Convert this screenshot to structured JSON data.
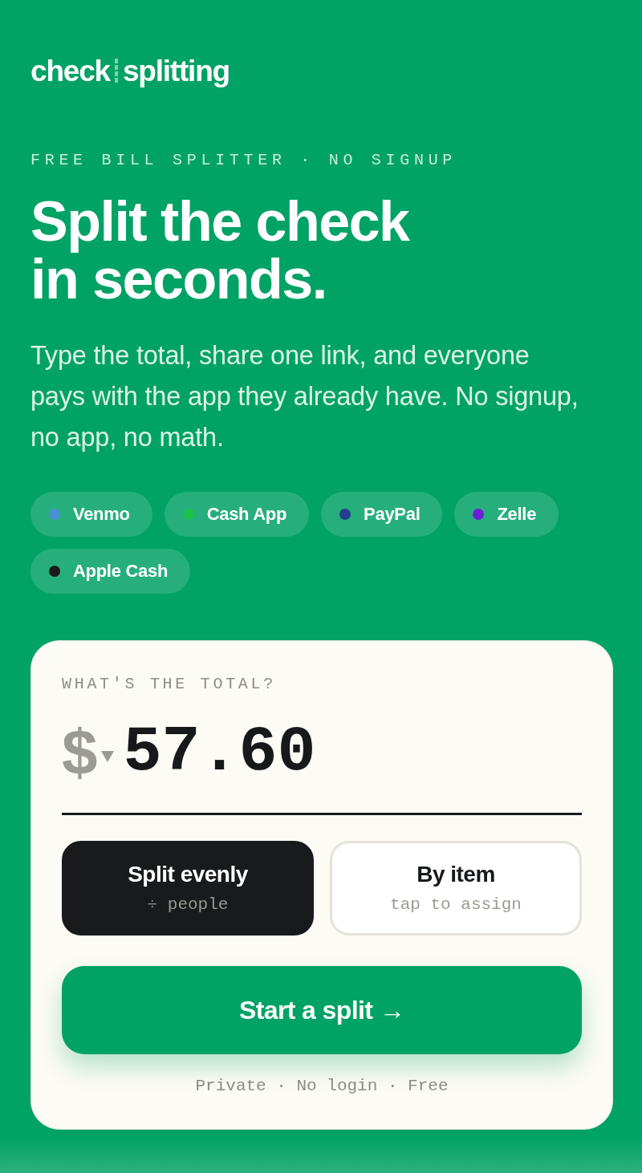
{
  "logo": {
    "words": [
      "check",
      "splitting"
    ]
  },
  "eyebrow": "FREE BILL SPLITTER · NO SIGNUP",
  "headline": {
    "lines": [
      "Split the check",
      "in seconds."
    ]
  },
  "subtitle": "Type the total, share one link, and everyone pays with the app they already have. No signup, no app, no math.",
  "payment_apps": [
    {
      "name": "Venmo",
      "color": "#4a8fd4"
    },
    {
      "name": "Cash App",
      "color": "#1cc14b"
    },
    {
      "name": "PayPal",
      "color": "#233e8b"
    },
    {
      "name": "Zelle",
      "color": "#6b1fd6"
    },
    {
      "name": "Apple Cash",
      "color": "#1b1b1b"
    }
  ],
  "card": {
    "label": "WHAT'S THE TOTAL?",
    "currency": "$",
    "value": "57.60",
    "modes": [
      {
        "title": "Split evenly",
        "subtitle": "÷ people",
        "selected": true
      },
      {
        "title": "By item",
        "subtitle": "tap to assign",
        "selected": false
      }
    ],
    "cta": "Start a split →",
    "footnote": "Private · No login · Free"
  }
}
